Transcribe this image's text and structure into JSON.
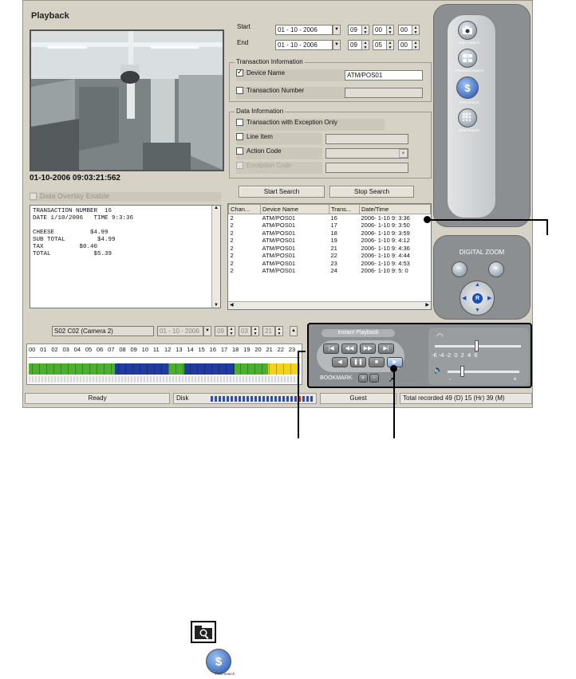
{
  "window": {
    "title": "Playback",
    "timestamp": "01-10-2006 09:03:21:562",
    "overlay_label": "Data Overlay Enable"
  },
  "time_range": {
    "start_label": "Start",
    "end_label": "End",
    "start_date": "01 - 10 - 2006",
    "start_hour": "09",
    "start_min": "00",
    "start_sec": "00",
    "end_date": "01 - 10 - 2006",
    "end_hour": "09",
    "end_min": "05",
    "end_sec": "00"
  },
  "transaction_info": {
    "group_title": "Transaction Information",
    "device_name_label": "Device Name",
    "device_name_checked": true,
    "device_name_value": "ATM/POS01",
    "transaction_number_label": "Transaction Number",
    "transaction_number_value": ""
  },
  "data_info": {
    "group_title": "Data Information",
    "exception_only_label": "Transaction with Exception Only",
    "line_item_label": "Line Item",
    "action_code_label": "Action Code",
    "exception_code_label": "Exception Code"
  },
  "search": {
    "start_label": "Start Search",
    "stop_label": "Stop Search"
  },
  "overlay_text": "TRANSACTION NUMBER  16\nDATE 1/10/2006   TIME 9:3:36\n\nCHEESE          $4.99\nSUB TOTAL         $4.99\nTAX          $0.40\nTOTAL            $5.39",
  "results": {
    "columns": [
      "Chan...",
      "Device Name",
      "Trans...",
      "Date/Time"
    ],
    "rows": [
      [
        "2",
        "ATM/POS01",
        "16",
        "2006- 1-10  9: 3:36"
      ],
      [
        "2",
        "ATM/POS01",
        "17",
        "2006- 1-10  9: 3:50"
      ],
      [
        "2",
        "ATM/POS01",
        "18",
        "2006- 1-10  9: 3:59"
      ],
      [
        "2",
        "ATM/POS01",
        "19",
        "2006- 1-10  9: 4:12"
      ],
      [
        "2",
        "ATM/POS01",
        "21",
        "2006- 1-10  9: 4:36"
      ],
      [
        "2",
        "ATM/POS01",
        "22",
        "2006- 1-10  9: 4:44"
      ],
      [
        "2",
        "ATM/POS01",
        "23",
        "2006- 1-10  9: 4:53"
      ],
      [
        "2",
        "ATM/POS01",
        "24",
        "2006- 1-10  9: 5: 0"
      ]
    ]
  },
  "side_panel": {
    "buttons": [
      "Index Search",
      "Thumbnail Search",
      "POS Search",
      "Pixel Search"
    ],
    "zoom_title": "DIGITAL ZOOM",
    "zoom_center": "R"
  },
  "timeline": {
    "camera": "S02 C02 (Camera 2)",
    "date": "01 - 10 - 2006",
    "hour": "09",
    "min": "03",
    "sec": "21",
    "hours": [
      "00",
      "01",
      "02",
      "03",
      "04",
      "05",
      "06",
      "07",
      "08",
      "09",
      "10",
      "11",
      "12",
      "13",
      "14",
      "15",
      "16",
      "17",
      "18",
      "19",
      "20",
      "21",
      "22",
      "23"
    ]
  },
  "playback": {
    "title": "Instant Playback",
    "bookmark_label": "BOOKMARK",
    "bookmark_add": "+",
    "bookmark_remove": "-",
    "speed_scale": "-6 -4 -2  0  2  4  6",
    "vol_minus": "-",
    "vol_plus": "+"
  },
  "status": {
    "ready": "Ready",
    "disk_label": "Disk",
    "user": "Guest",
    "recorded": "Total recorded 49 (D) 15 (Hr) 39 (M)"
  },
  "colors": {
    "timeline_green": "#4caf2f",
    "timeline_blue": "#1f3c9e",
    "timeline_yellow": "#f2d21a",
    "disk_blue": "#2a4fb5",
    "disk_red": "#d62b22"
  }
}
